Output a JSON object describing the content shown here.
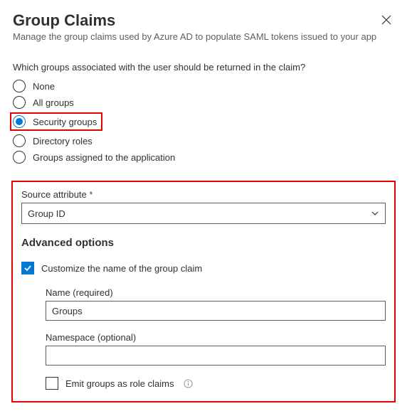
{
  "header": {
    "title": "Group Claims",
    "subtitle": "Manage the group claims used by Azure AD to populate SAML tokens issued to your app"
  },
  "question": "Which groups associated with the user should be returned in the claim?",
  "radio_options": {
    "none": "None",
    "all": "All groups",
    "security": "Security groups",
    "directory": "Directory roles",
    "assigned": "Groups assigned to the application",
    "selected": "security"
  },
  "source_attribute": {
    "label": "Source attribute",
    "value": "Group ID"
  },
  "advanced": {
    "title": "Advanced options",
    "customize_label": "Customize the name of the group claim",
    "name_label": "Name (required)",
    "name_value": "Groups",
    "namespace_label": "Namespace (optional)",
    "namespace_value": "",
    "emit_label": "Emit groups as role claims"
  }
}
